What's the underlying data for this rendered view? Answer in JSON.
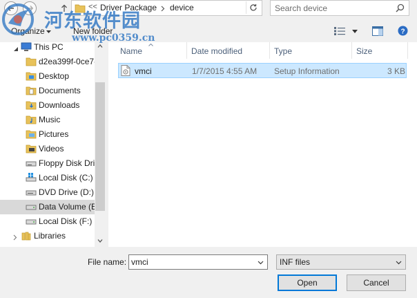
{
  "address_bar": {
    "breadcrumbs": [
      "Driver Package",
      "device"
    ],
    "overflow": "<<"
  },
  "search": {
    "placeholder": "Search device"
  },
  "watermark": {
    "title": "河东软件园",
    "url": "www.pc0359.cn"
  },
  "toolbar": {
    "organize_label": "Organize",
    "new_folder_label": "New folder"
  },
  "nav": {
    "items": [
      {
        "label": "This PC",
        "icon": "computer-icon"
      },
      {
        "label": "d2ea399f-0ce7-",
        "icon": "folder-icon"
      },
      {
        "label": "Desktop",
        "icon": "desktop-folder-icon"
      },
      {
        "label": "Documents",
        "icon": "documents-folder-icon"
      },
      {
        "label": "Downloads",
        "icon": "downloads-folder-icon"
      },
      {
        "label": "Music",
        "icon": "music-folder-icon"
      },
      {
        "label": "Pictures",
        "icon": "pictures-folder-icon"
      },
      {
        "label": "Videos",
        "icon": "videos-folder-icon"
      },
      {
        "label": "Floppy Disk Dri",
        "icon": "floppy-drive-icon"
      },
      {
        "label": "Local Disk (C:)",
        "icon": "windows-disk-icon"
      },
      {
        "label": "DVD Drive (D:)",
        "icon": "dvd-drive-icon"
      },
      {
        "label": "Data Volume (E",
        "icon": "disk-drive-icon",
        "selected": true
      },
      {
        "label": "Local Disk (F:)",
        "icon": "disk-drive-icon"
      },
      {
        "label": "Libraries",
        "icon": "libraries-icon"
      }
    ]
  },
  "columns": {
    "name": "Name",
    "date": "Date modified",
    "type": "Type",
    "size": "Size"
  },
  "files": [
    {
      "name": "vmci",
      "date": "1/7/2015 4:55 AM",
      "type": "Setup Information",
      "size": "3 KB",
      "icon": "setup-info-file-icon"
    }
  ],
  "bottom": {
    "file_name_label": "File name:",
    "file_name_value": "vmci",
    "file_type_value": "INF files",
    "open_label": "Open",
    "cancel_label": "Cancel"
  },
  "colors": {
    "accent": "#0078d7",
    "selection": "#cce8ff",
    "watermark": "#367ac4"
  }
}
